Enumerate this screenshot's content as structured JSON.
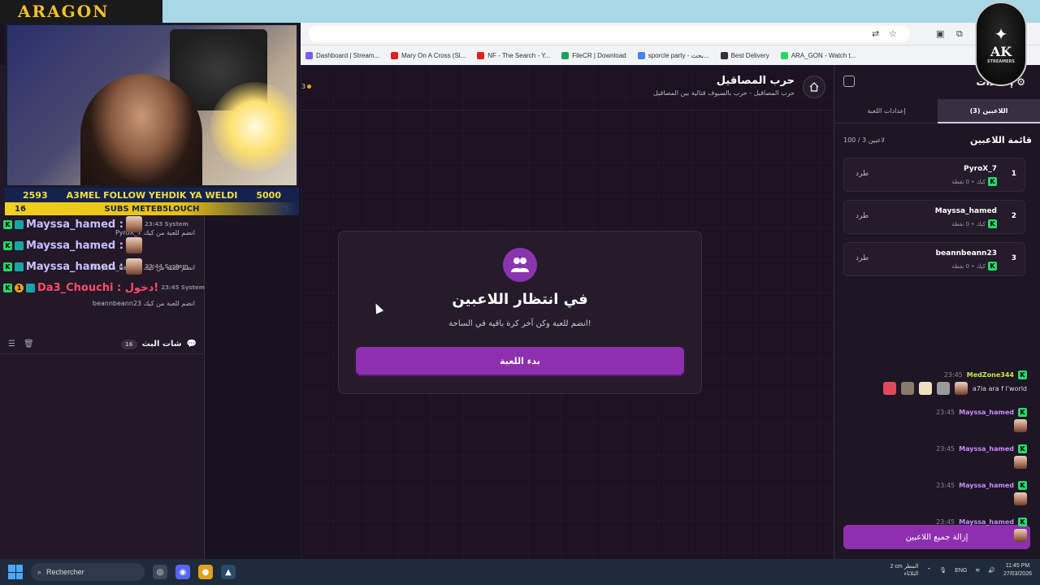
{
  "overlay": {
    "brand": "ARAGON",
    "ticker_left_num": "2593",
    "ticker_text": "A3MEL FOLLOW YEHDIK YA WELDI",
    "ticker_right_num": "5000",
    "subs_left_num": "16",
    "subs_text": "SUBS METEB5LOUCH",
    "subs_right_num": "25",
    "rows": [
      {
        "user": "Mayssa_hamed :",
        "faded": "23:43 System"
      },
      {
        "user": "Mayssa_hamed :",
        "faded": ""
      },
      {
        "user": "Mayssa_hamed :",
        "faded": "23:44 System"
      },
      {
        "user": "Da3_Chouchi : دخول!",
        "faded": "23:45 System"
      }
    ],
    "ak_letters": "AK",
    "ak_sub": "STREAMERS"
  },
  "browser": {
    "bookmarks": [
      {
        "label": "Dashboard | Stream...",
        "color": "#7a5af0"
      },
      {
        "label": "Mary On A Cross (Sl...",
        "color": "#e02020"
      },
      {
        "label": "NF - The Search - Y...",
        "color": "#e02020"
      },
      {
        "label": "FileCR | Download",
        "color": "#20a060"
      },
      {
        "label": "sporcle party - بحث...",
        "color": "#4285f4"
      },
      {
        "label": "Best Delivery",
        "color": "#333333"
      },
      {
        "label": "ARA_GON - Watch t...",
        "color": "#27d96a"
      }
    ]
  },
  "chat_log": [
    {
      "text": "PyroX_7 انضم للعبة من كيك"
    },
    {
      "text": "Mayssa_hamed انضم للعبة من كيك"
    },
    {
      "text": "beannbeann23 انضم للعبة من كيك"
    }
  ],
  "chat": {
    "title": "شات البث",
    "count": "16",
    "messages": [
      {
        "time": "23:45",
        "user": "MedZone344",
        "text": "a7la ara f l'world",
        "green": true
      },
      {
        "time": "23:45",
        "user": "Mayssa_hamed",
        "text": "",
        "green": false
      },
      {
        "time": "23:45",
        "user": "Mayssa_hamed",
        "text": "",
        "green": false
      },
      {
        "time": "23:45",
        "user": "Mayssa_hamed",
        "text": "",
        "green": false
      },
      {
        "time": "23:45",
        "user": "Mayssa_hamed",
        "text": "",
        "green": false
      }
    ]
  },
  "game": {
    "title": "حرب المصاقيل",
    "subtitle": "حرب المصاقيل - حرب بالسيوف قتالية بين المصاقيل",
    "player_count": "3",
    "waiting_title": "في انتظار اللاعبين",
    "waiting_sub": "انضم للعبة وكن آخر كرة باقية في الساحة!",
    "start_label": "بدء اللعبة"
  },
  "settings": {
    "title": "إعدادات",
    "tabs": [
      "إعدادات اللعبة",
      "اللاعبين (3)"
    ],
    "list_title": "قائمة اللاعبين",
    "list_count": "100 / 3 لاعبين",
    "kick_label": "طرد",
    "players": [
      {
        "rank": "1",
        "name": "PyroX_7",
        "meta": "كيك • 0 نقطة"
      },
      {
        "rank": "2",
        "name": "Mayssa_hamed",
        "meta": "كيك • 0 نقطة"
      },
      {
        "rank": "3",
        "name": "beannbeann23",
        "meta": "كيك • 0 نقطة"
      }
    ],
    "remove_all_label": "إزالة جميع اللاعبين"
  },
  "taskbar": {
    "search_label": "Rechercher",
    "weather_temp": "2 cm المطر",
    "weather_day": "الثلاثاء",
    "lang": "ENG",
    "time": "11:45 PM",
    "date": "27/03/2026"
  }
}
